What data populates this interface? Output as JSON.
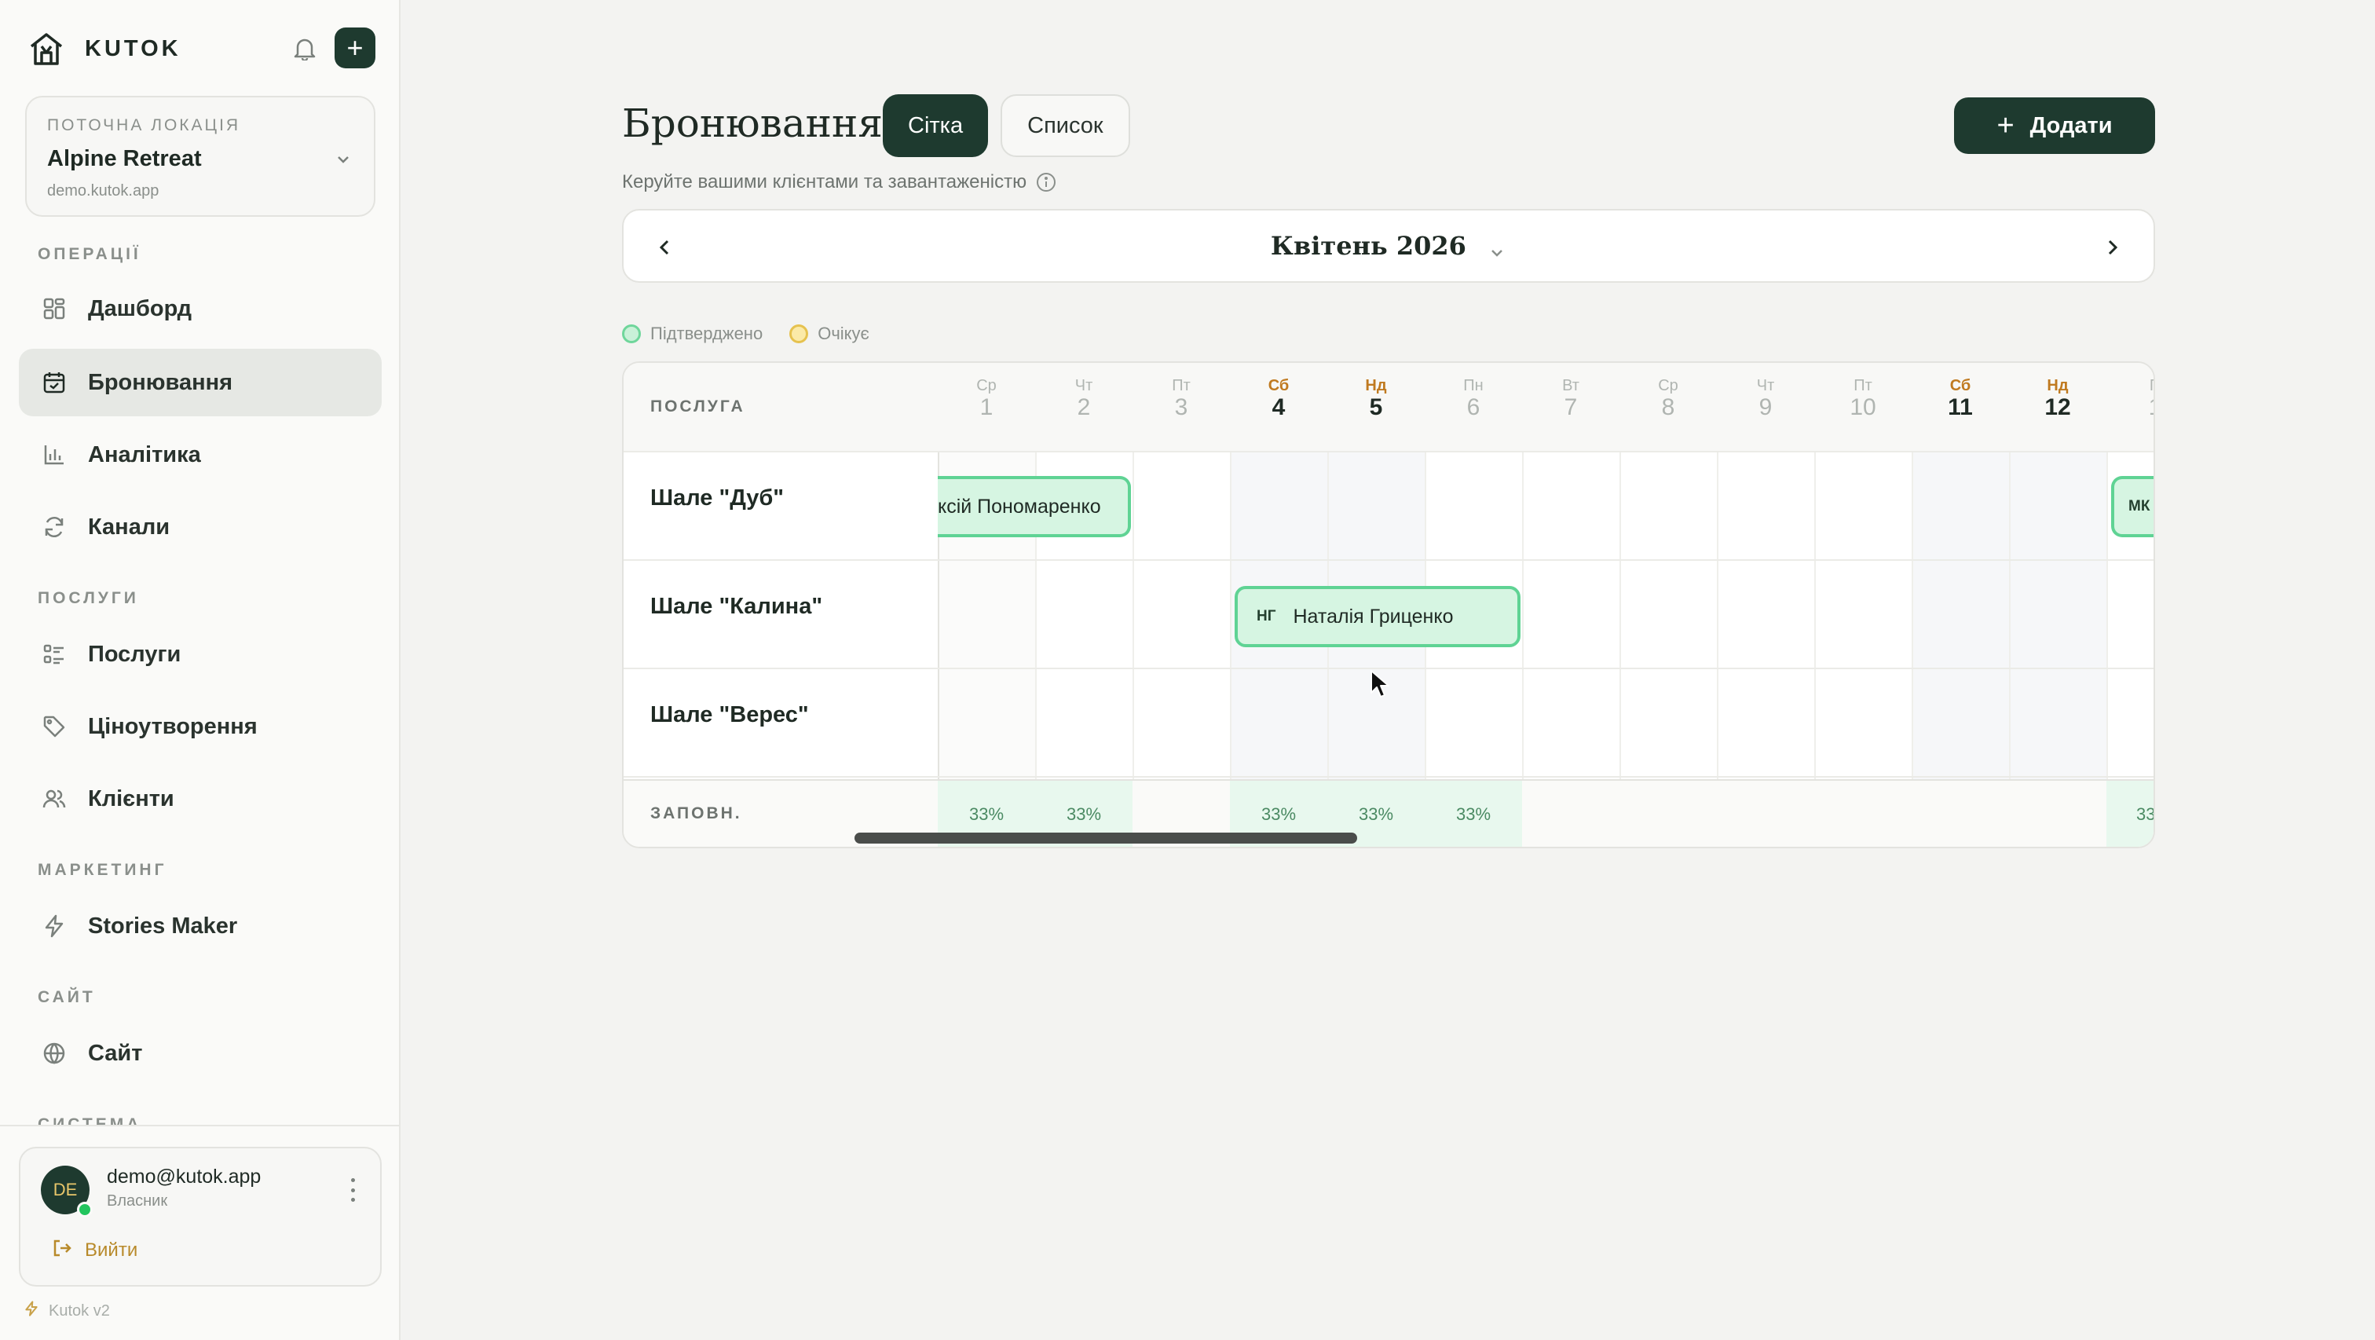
{
  "brand": {
    "name": "KUTOK"
  },
  "location": {
    "label": "ПОТОЧНА ЛОКАЦІЯ",
    "name": "Alpine Retreat",
    "url": "demo.kutok.app"
  },
  "sections": {
    "operations": "ОПЕРАЦІЇ",
    "services": "ПОСЛУГИ",
    "marketing": "МАРКЕТИНГ",
    "site": "САЙТ",
    "system": "СИСТЕМА"
  },
  "nav": {
    "dashboard": "Дашборд",
    "bookings": "Бронювання",
    "analytics": "Аналітика",
    "channels": "Канали",
    "services": "Послуги",
    "pricing": "Ціноутворення",
    "clients": "Клієнти",
    "stories": "Stories Maker",
    "site": "Сайт"
  },
  "user": {
    "initials": "DE",
    "email": "demo@kutok.app",
    "role": "Власник",
    "logout": "Вийти"
  },
  "version": "Kutok v2",
  "page": {
    "title": "Бронювання",
    "view_grid": "Сітка",
    "view_list": "Список",
    "subtitle": "Керуйте вашими клієнтами та завантаженістю",
    "add_label": "Додати"
  },
  "calendar": {
    "month": "Квітень 2026",
    "legend": {
      "confirmed": "Підтверджено",
      "pending": "Очікує"
    },
    "service_header": "ПОСЛУГА",
    "occupancy_label": "ЗАПОВН.",
    "days": [
      {
        "dow": "Ср",
        "num": "1"
      },
      {
        "dow": "Чт",
        "num": "2"
      },
      {
        "dow": "Пт",
        "num": "3"
      },
      {
        "dow": "Сб",
        "num": "4"
      },
      {
        "dow": "Нд",
        "num": "5"
      },
      {
        "dow": "Пн",
        "num": "6"
      },
      {
        "dow": "Вт",
        "num": "7"
      },
      {
        "dow": "Ср",
        "num": "8"
      },
      {
        "dow": "Чт",
        "num": "9"
      },
      {
        "dow": "Пт",
        "num": "10"
      },
      {
        "dow": "Сб",
        "num": "11"
      },
      {
        "dow": "Нд",
        "num": "12"
      },
      {
        "dow": "П",
        "num": "1"
      }
    ],
    "rows": [
      "Шале \"Дуб\"",
      "Шале \"Калина\"",
      "Шале \"Верес\""
    ],
    "bookings": {
      "b1": {
        "name": "ксій Пономаренко"
      },
      "b2": {
        "initials": "НГ",
        "name": "Наталія Гриценко"
      },
      "b3": {
        "initials": "МК"
      }
    },
    "occupancy": {
      "o1": "33%",
      "o2": "33%",
      "o4": "33%",
      "o5": "33%",
      "o6": "33%",
      "o13": "33"
    }
  },
  "colors": {
    "accent": "#1e3a2f",
    "confirmed": "#5fd394",
    "pending": "#e6c24f"
  }
}
